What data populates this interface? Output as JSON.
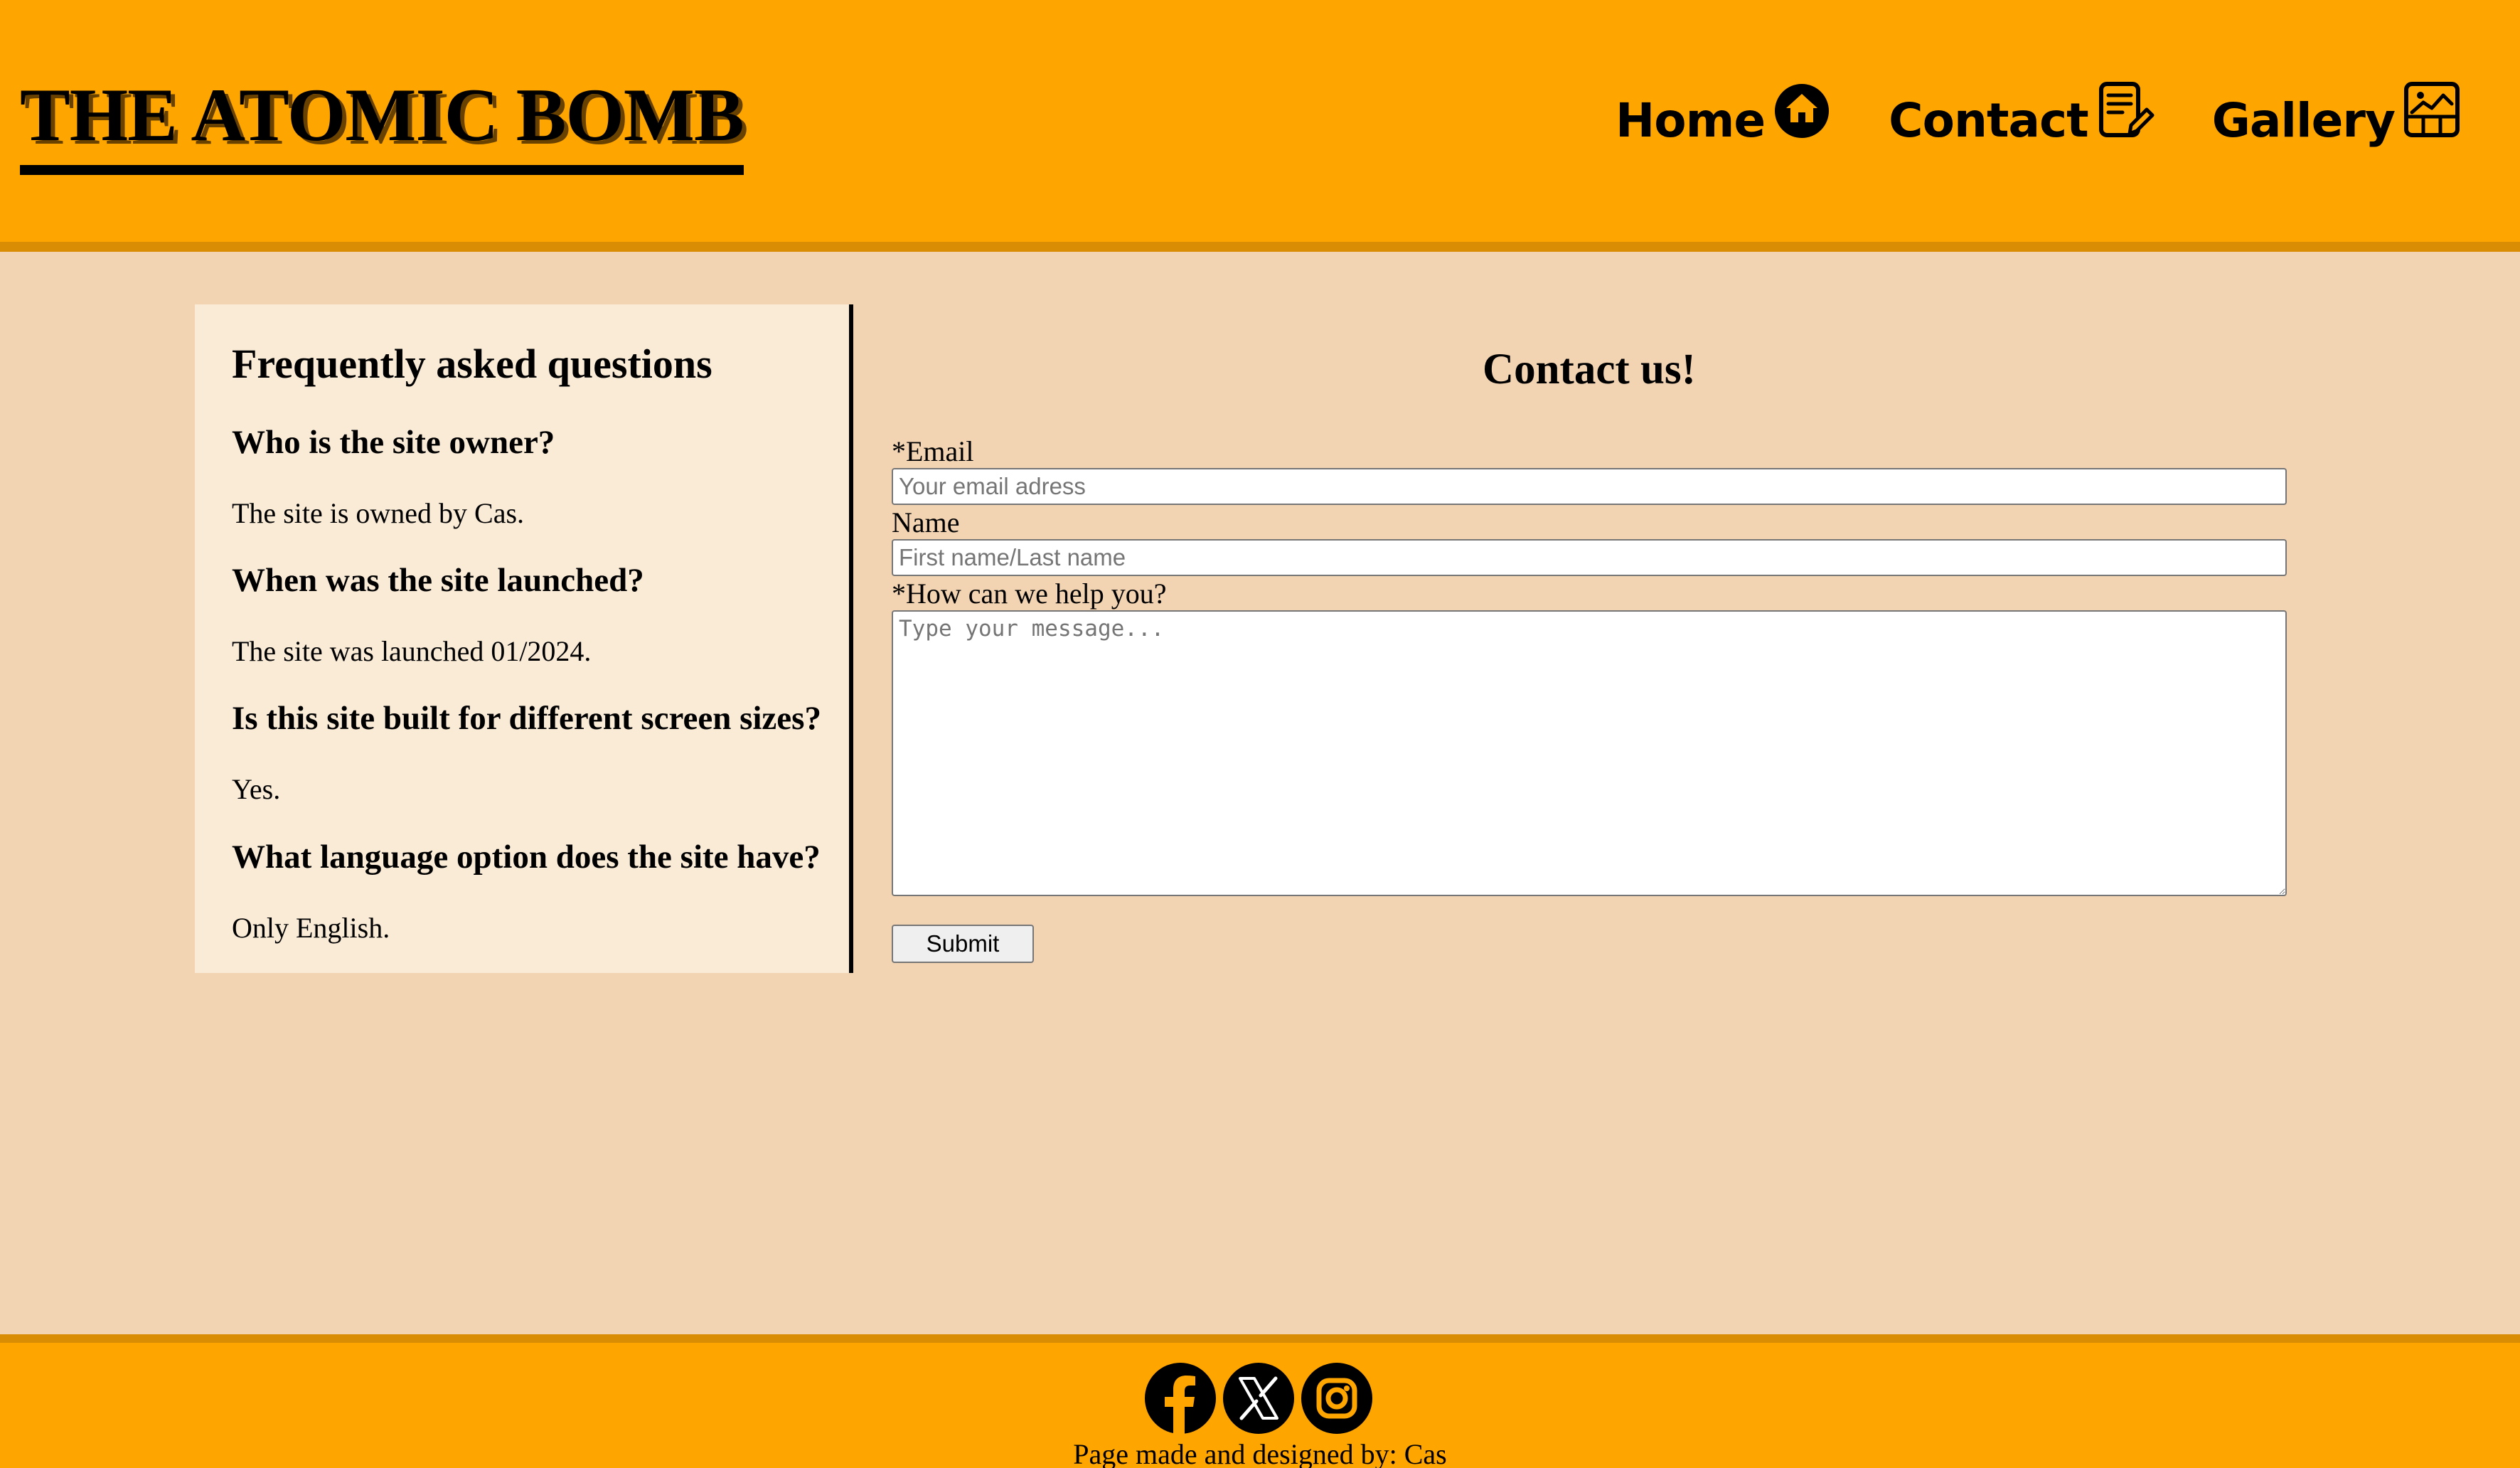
{
  "header": {
    "logo": "THE ATOMIC BOMB",
    "nav": [
      {
        "label": "Home",
        "icon": "home-icon"
      },
      {
        "label": "Contact",
        "icon": "contact-form-icon"
      },
      {
        "label": "Gallery",
        "icon": "gallery-icon"
      }
    ]
  },
  "faq": {
    "title": "Frequently asked questions",
    "items": [
      {
        "question": "Who is the site owner?",
        "answer": "The site is owned by Cas."
      },
      {
        "question": "When was the site launched?",
        "answer": "The site was launched 01/2024."
      },
      {
        "question": "Is this site built for different screen sizes?",
        "answer": "Yes."
      },
      {
        "question": "What language option does the site have?",
        "answer": "Only English."
      }
    ]
  },
  "contact": {
    "title": "Contact us!",
    "email_label": "*Email",
    "email_placeholder": "Your email adress",
    "name_label": "Name",
    "name_placeholder": "First name/Last name",
    "message_label": "*How can we help you?",
    "message_placeholder": "Type your message...",
    "submit_label": "Submit"
  },
  "footer": {
    "social": [
      "facebook-icon",
      "x-icon",
      "instagram-icon"
    ],
    "credit": "Page made and designed by: Cas"
  },
  "colors": {
    "header_bg": "#ffa500",
    "header_border": "#d98d05",
    "page_bg": "#f2d4b2",
    "faq_bg": "#faebd7"
  }
}
